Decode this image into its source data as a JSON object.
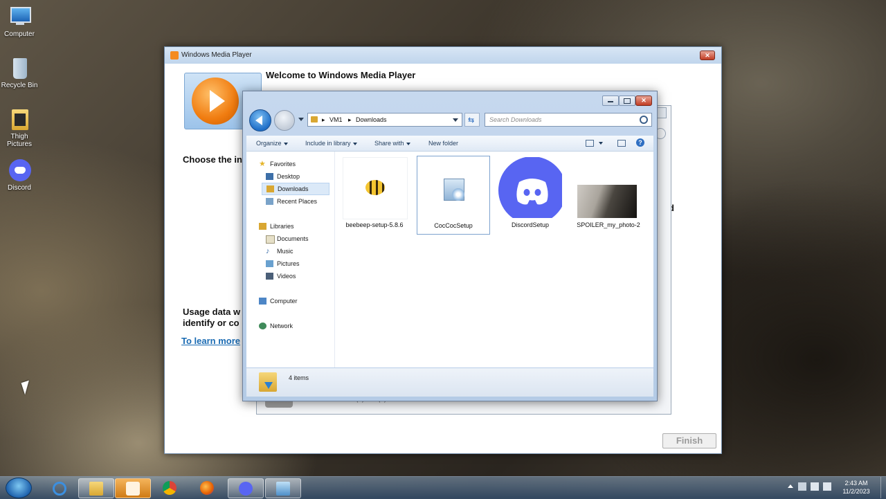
{
  "desktop": {
    "icons": [
      {
        "label": "Computer"
      },
      {
        "label": "Recycle Bin"
      },
      {
        "label": "Thigh Pictures"
      },
      {
        "label": "Discord"
      }
    ]
  },
  "wmp": {
    "title": "Windows Media Player",
    "welcome": "Welcome to Windows Media Player",
    "choose_text": "Choose the in",
    "usage_line1": "Usage data w",
    "usage_line2": "identify or co",
    "learn_more": "To learn more",
    "partial_right": "d",
    "finish_label": "Finish"
  },
  "behind_window": {
    "processor_text": "Processor: Intel(R) Xeon(R) CPU E5..."
  },
  "explorer": {
    "breadcrumb": [
      "VM1",
      "Downloads"
    ],
    "search_placeholder": "Search Downloads",
    "toolbar": {
      "organize": "Organize",
      "include": "Include in library",
      "share": "Share with",
      "new_folder": "New folder"
    },
    "sidebar": {
      "favorites": "Favorites",
      "desktop": "Desktop",
      "downloads": "Downloads",
      "recent": "Recent Places",
      "libraries": "Libraries",
      "documents": "Documents",
      "music": "Music",
      "pictures": "Pictures",
      "videos": "Videos",
      "computer": "Computer",
      "network": "Network"
    },
    "files": [
      {
        "name": "beebeep-setup-5.8.6"
      },
      {
        "name": "CocCocSetup"
      },
      {
        "name": "DiscordSetup"
      },
      {
        "name": "SPOILER_my_photo-2"
      }
    ],
    "status_count": "4 items"
  },
  "taskbar": {
    "time": "2:43 AM",
    "date": "11/2/2023"
  },
  "colors": {
    "discord": "#5865F2",
    "link": "#1a6bb3",
    "wmp_orange": "#f07c10"
  }
}
